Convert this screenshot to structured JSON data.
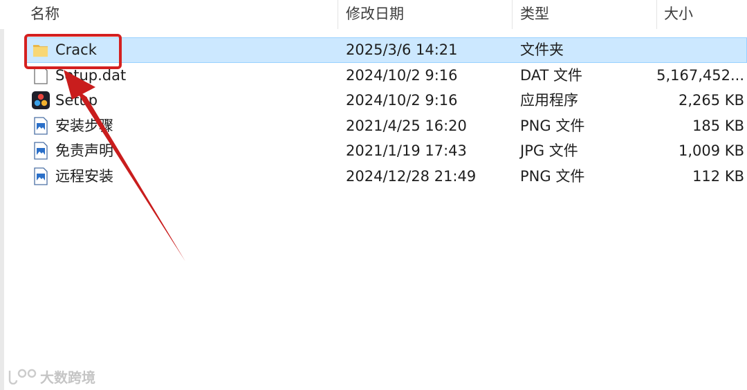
{
  "columns": {
    "name": "名称",
    "date": "修改日期",
    "type": "类型",
    "size": "大小"
  },
  "files": [
    {
      "name": "Crack",
      "date": "2025/3/6 14:21",
      "type": "文件夹",
      "size": "",
      "icon": "folder-icon",
      "selected": true
    },
    {
      "name": "Setup.dat",
      "date": "2024/10/2 9:16",
      "type": "DAT 文件",
      "size": "5,167,452...",
      "icon": "blank-file-icon"
    },
    {
      "name": "Setup",
      "date": "2024/10/2 9:16",
      "type": "应用程序",
      "size": "2,265 KB",
      "icon": "davinci-resolve-app-icon"
    },
    {
      "name": "安装步骤",
      "date": "2021/4/25 16:20",
      "type": "PNG 文件",
      "size": "185 KB",
      "icon": "image-file-icon"
    },
    {
      "name": "免责声明",
      "date": "2021/1/19 17:43",
      "type": "JPG 文件",
      "size": "1,009 KB",
      "icon": "image-file-icon"
    },
    {
      "name": "远程安装",
      "date": "2024/12/28 21:49",
      "type": "PNG 文件",
      "size": "112 KB",
      "icon": "image-file-icon"
    }
  ],
  "watermark": {
    "text": "大数跨境"
  },
  "colors": {
    "selection_bg": "#cce8ff",
    "selection_border": "#99d1ff",
    "annotation_red": "#d42020",
    "folder_yellow": "#f8d775"
  }
}
